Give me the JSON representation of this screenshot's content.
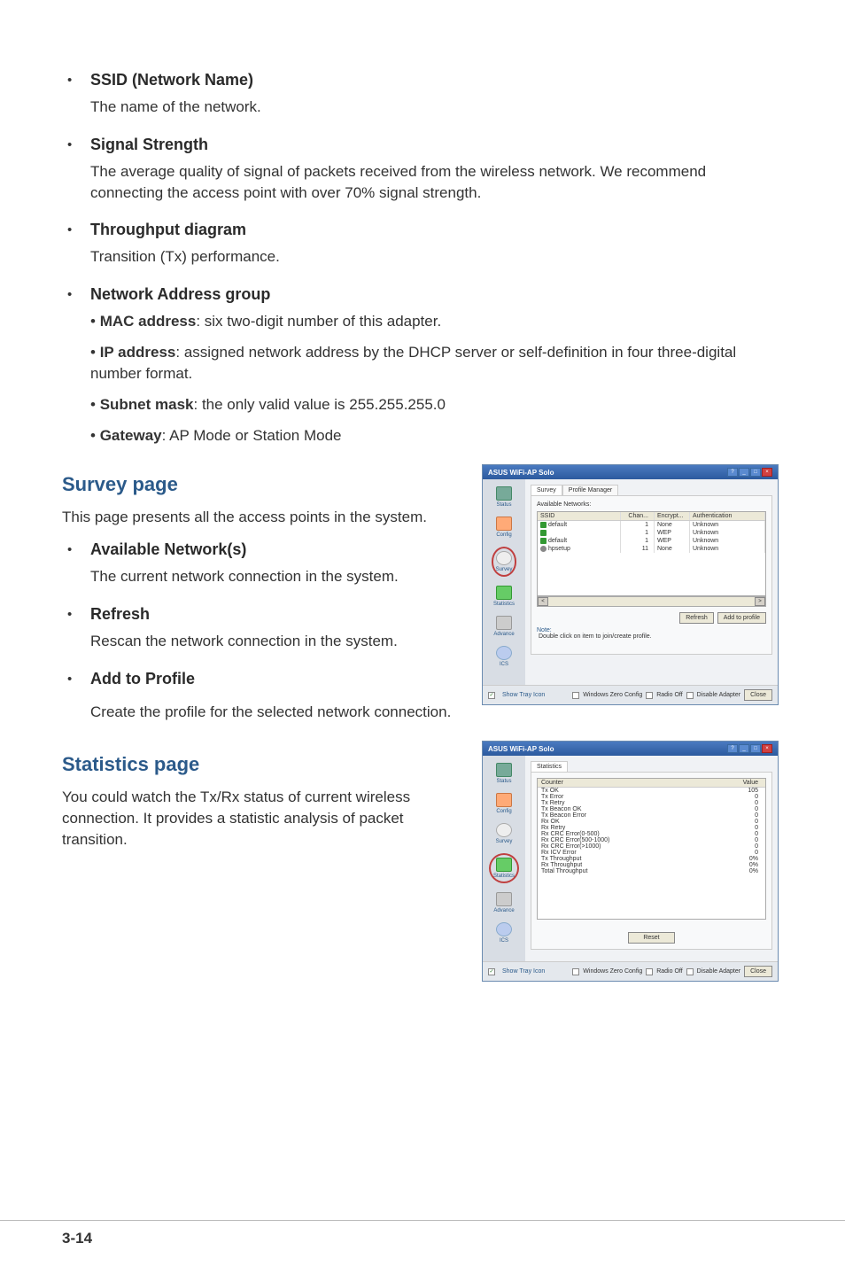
{
  "bullets_top": [
    {
      "title": "SSID (Network Name)",
      "desc": "The name of the network."
    },
    {
      "title": "Signal Strength",
      "desc": "The average quality of signal of packets received from the wireless network. We recommend connecting the access point with over 70% signal strength."
    },
    {
      "title": "Throughput diagram",
      "desc": "Transition (Tx) performance."
    },
    {
      "title": "Network Address group",
      "subs": [
        {
          "b": "MAC address",
          "t": ": six two-digit number of this adapter."
        },
        {
          "b": "IP address",
          "t": ": assigned network address by the DHCP server or self-definition in four three-digital number format."
        },
        {
          "b": "Subnet mask",
          "t": ": the only valid value is 255.255.255.0"
        },
        {
          "b": "Gateway",
          "t": ": AP Mode or Station Mode"
        }
      ]
    }
  ],
  "survey": {
    "title": "Survey page",
    "desc": "This page presents all the access points in the system.",
    "items": [
      {
        "title": "Available Network(s)",
        "desc": "The current network connection in the system."
      },
      {
        "title": "Refresh",
        "desc": "Rescan the network connection in the system."
      },
      {
        "title": "Add to Profile",
        "desc": "Create the profile for the selected network connection."
      }
    ]
  },
  "statistics": {
    "title": "Statistics page",
    "desc": "You could watch the Tx/Rx status of current wireless connection. It provides a statistic analysis of packet transition."
  },
  "app": {
    "title": "ASUS WiFi-AP Solo",
    "sidebar": [
      "Status",
      "Config",
      "Survey",
      "Statistics",
      "Advance",
      "ICS"
    ],
    "survey_tabs": [
      "Survey",
      "Profile Manager"
    ],
    "available_label": "Available Networks:",
    "net_cols": {
      "ssid": "SSID",
      "chan": "Chan...",
      "enc": "Encrypt...",
      "auth": "Authentication"
    },
    "net_rows": [
      {
        "icon": "i",
        "ssid": "default",
        "chan": "1",
        "enc": "None",
        "auth": "Unknown"
      },
      {
        "icon": "i",
        "ssid": "",
        "chan": "1",
        "enc": "WEP",
        "auth": "Unknown"
      },
      {
        "icon": "i",
        "ssid": "default",
        "chan": "1",
        "enc": "WEP",
        "auth": "Unknown"
      },
      {
        "icon": "g",
        "ssid": "hpsetup",
        "chan": "11",
        "enc": "None",
        "auth": "Unknown"
      }
    ],
    "refresh_btn": "Refresh",
    "add_profile_btn": "Add to profile",
    "note_label": "Note:",
    "note_text": "Double click on item to join/create profile.",
    "footer_show_tray": "Show Tray Icon",
    "footer_zero": "Windows Zero Config",
    "footer_radio": "Radio Off",
    "footer_disable": "Disable Adapter",
    "footer_close": "Close",
    "stats_tab": "Statistics",
    "stats_cols": {
      "counter": "Counter",
      "value": "Value"
    },
    "stats_rows": [
      {
        "c": "Tx OK",
        "v": "105"
      },
      {
        "c": "Tx Error",
        "v": "0"
      },
      {
        "c": "Tx Retry",
        "v": "0"
      },
      {
        "c": "Tx Beacon OK",
        "v": "0"
      },
      {
        "c": "Tx Beacon Error",
        "v": "0"
      },
      {
        "c": "Rx OK",
        "v": "0"
      },
      {
        "c": "Rx Retry",
        "v": "0"
      },
      {
        "c": "Rx CRC Error(0-500)",
        "v": "0"
      },
      {
        "c": "Rx CRC Error(500-1000)",
        "v": "0"
      },
      {
        "c": "Rx CRC Error(>1000)",
        "v": "0"
      },
      {
        "c": "Rx ICV Error",
        "v": "0"
      },
      {
        "c": "Tx Throughput",
        "v": "0%"
      },
      {
        "c": "Rx Throughput",
        "v": "0%"
      },
      {
        "c": "Total Throughput",
        "v": "0%"
      }
    ],
    "reset_btn": "Reset"
  },
  "page_number": "3-14"
}
